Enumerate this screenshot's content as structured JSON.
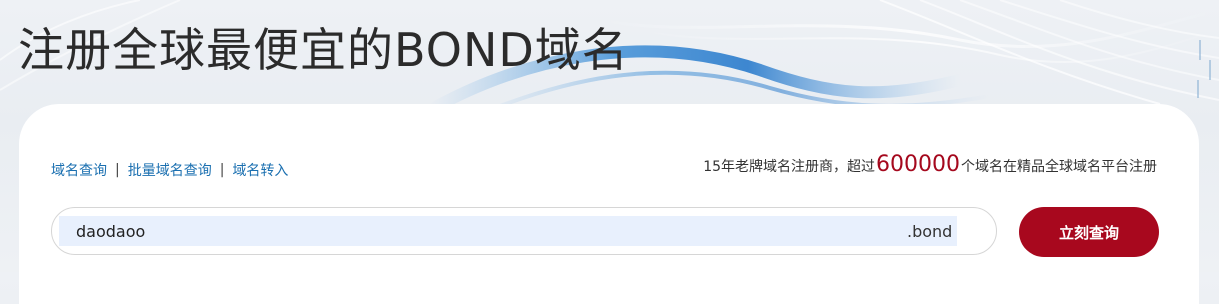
{
  "hero": {
    "title": "注册全球最便宜的BOND域名"
  },
  "quick_links": [
    {
      "label": "域名查询"
    },
    {
      "label": "批量域名查询"
    },
    {
      "label": "域名转入"
    }
  ],
  "separator": "|",
  "promo": {
    "prefix": "15年老牌域名注册商，超过",
    "count": "600000",
    "suffix": "个域名在精品全球域名平台注册"
  },
  "search": {
    "value": "daodaoo",
    "tld": ".bond",
    "button_label": "立刻查询"
  },
  "colors": {
    "accent": "#a8081e",
    "link": "#1a6fb0",
    "input_highlight": "#e8f0fd"
  }
}
